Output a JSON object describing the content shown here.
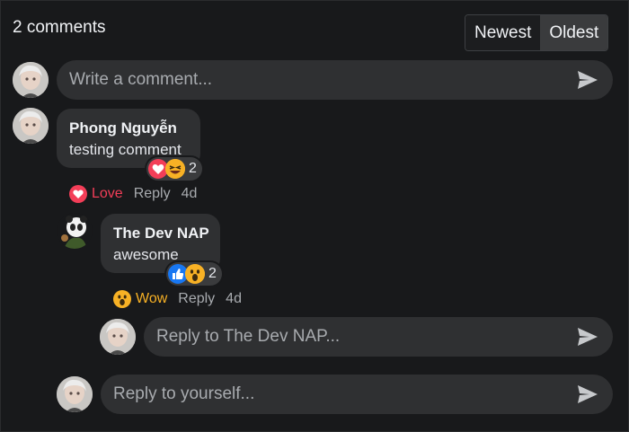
{
  "header": {
    "count_label": "2 comments",
    "sort_newest": "Newest",
    "sort_oldest": "Oldest"
  },
  "composer": {
    "placeholder": "Write a comment..."
  },
  "comments": [
    {
      "author": "Phong Nguyễn",
      "text": "testing comment",
      "reaction_count": "2",
      "reactions": [
        "heart-icon",
        "laughing-emoji"
      ],
      "my_reaction_label": "Love",
      "reply_label": "Reply",
      "time": "4d",
      "replies": [
        {
          "author": "The Dev NAP",
          "text": "awesome",
          "reaction_count": "2",
          "reactions": [
            "like-icon",
            "wow-emoji"
          ],
          "my_reaction_label": "Wow",
          "reply_label": "Reply",
          "time": "4d"
        }
      ]
    }
  ],
  "reply_composer_nested": {
    "placeholder": "Reply to The Dev NAP..."
  },
  "reply_composer_self": {
    "placeholder": "Reply to yourself..."
  },
  "colors": {
    "background": "#18191b",
    "bubble": "#2f3032",
    "love": "#f33e58",
    "wow": "#f7b125",
    "like": "#1877f2"
  }
}
